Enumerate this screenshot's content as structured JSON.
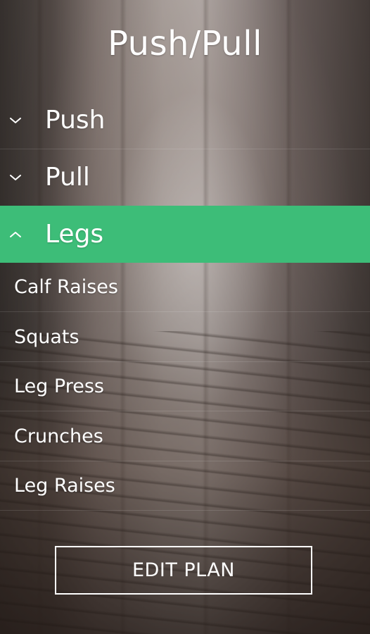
{
  "plan": {
    "title": "Push/Pull"
  },
  "groups": [
    {
      "label": "Push",
      "state": "collapsed",
      "icon": "chevron-down-icon"
    },
    {
      "label": "Pull",
      "state": "collapsed",
      "icon": "chevron-down-icon"
    },
    {
      "label": "Legs",
      "state": "expanded",
      "icon": "chevron-up-icon"
    }
  ],
  "exercises": [
    {
      "label": "Calf Raises"
    },
    {
      "label": "Squats"
    },
    {
      "label": "Leg Press"
    },
    {
      "label": "Crunches"
    },
    {
      "label": "Leg Raises"
    }
  ],
  "actions": {
    "edit_label": "EDIT PLAN"
  },
  "colors": {
    "accent": "#3dbd78",
    "text": "#ffffff"
  }
}
